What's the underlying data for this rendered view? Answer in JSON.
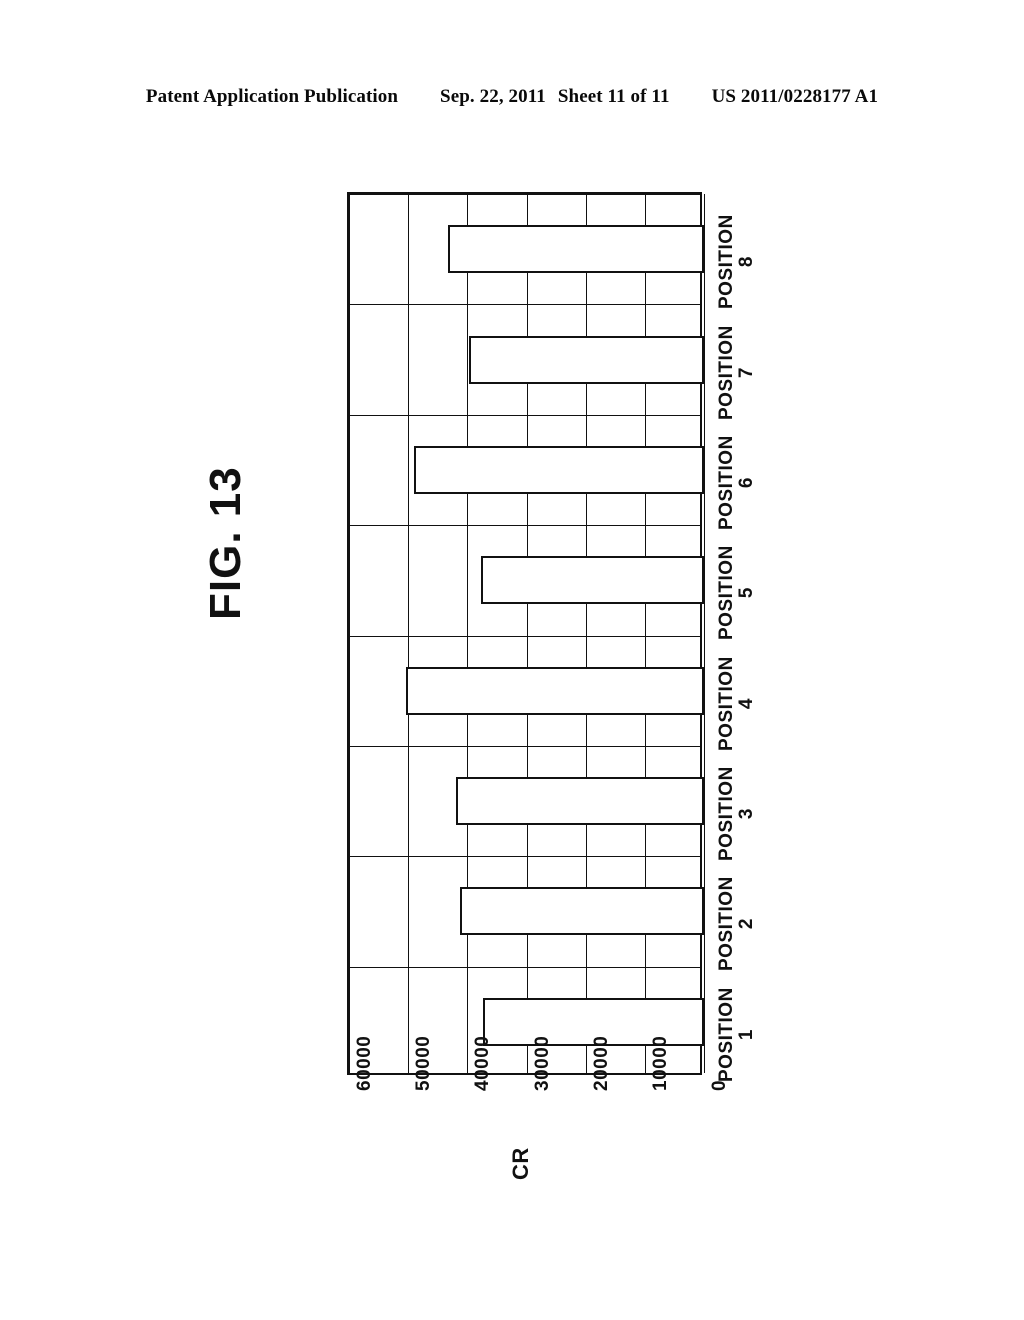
{
  "header": {
    "publication": "Patent Application Publication",
    "date": "Sep. 22, 2011",
    "sheet": "Sheet 11 of 11",
    "patent_number": "US 2011/0228177 A1"
  },
  "figure": {
    "title": "FIG. 13"
  },
  "chart_data": {
    "type": "bar",
    "orientation": "vertical-rotated-90",
    "title": "FIG. 13",
    "xlabel": "",
    "ylabel": "CR",
    "categories": [
      "POSITION 1",
      "POSITION 2",
      "POSITION 3",
      "POSITION 4",
      "POSITION 5",
      "POSITION 6",
      "POSITION 7",
      "POSITION 8"
    ],
    "category_names": [
      "POSITION",
      "POSITION",
      "POSITION",
      "POSITION",
      "POSITION",
      "POSITION",
      "POSITION",
      "POSITION"
    ],
    "category_numbers": [
      "1",
      "2",
      "3",
      "4",
      "5",
      "6",
      "7",
      "8"
    ],
    "values": [
      37300,
      41200,
      41900,
      50300,
      37700,
      49000,
      39700,
      43200
    ],
    "ylim": [
      0,
      60000
    ],
    "ytick_labels": [
      "60000",
      "50000",
      "40000",
      "30000",
      "20000",
      "10000",
      "0"
    ],
    "yticks": [
      60000,
      50000,
      40000,
      30000,
      20000,
      10000,
      0
    ],
    "grid": true,
    "legend": "none",
    "bar_fill": "#ffffff",
    "bar_edge": "#111111"
  }
}
